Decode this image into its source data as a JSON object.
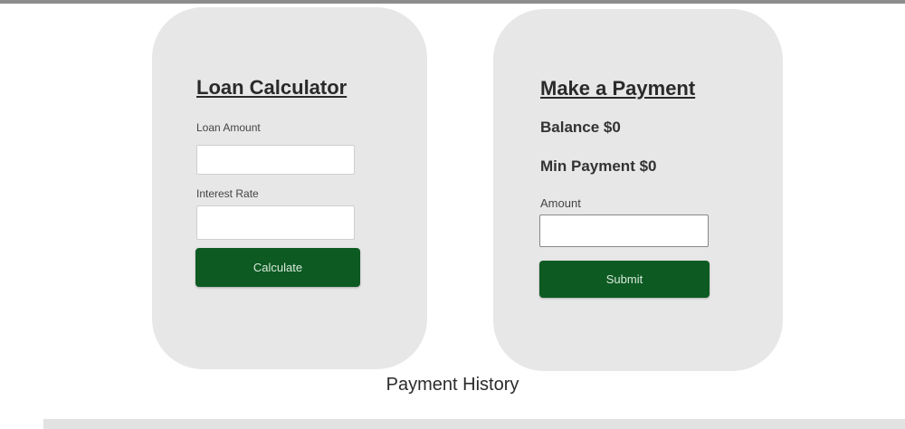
{
  "loan_calculator": {
    "title": "Loan Calculator",
    "amount_label": "Loan Amount",
    "amount_value": "",
    "rate_label": "Interest Rate",
    "rate_value": "",
    "button_label": "Calculate"
  },
  "make_payment": {
    "title": "Make a Payment",
    "balance_text": "Balance $0",
    "min_payment_text": "Min Payment $0",
    "amount_label": "Amount",
    "amount_value": "",
    "button_label": "Submit"
  },
  "payment_history": {
    "heading": "Payment History"
  },
  "colors": {
    "card_background": "#e7e7e7",
    "button_green": "#0d5a22",
    "page_background": "#ffffff"
  }
}
